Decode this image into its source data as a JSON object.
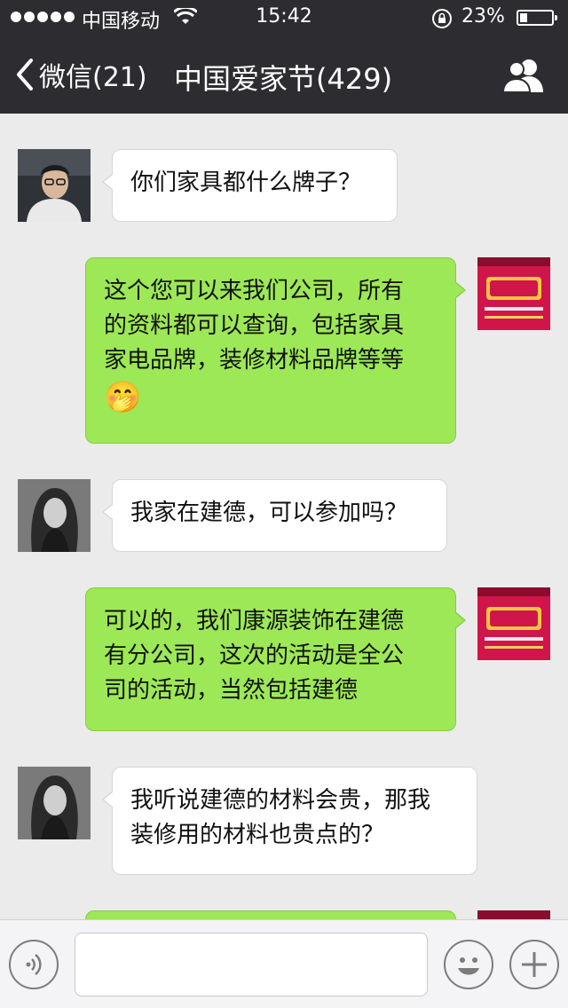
{
  "status_bar": {
    "carrier": "中国移动",
    "time": "15:42",
    "battery_percent_text": "23%",
    "battery_level": 0.23
  },
  "nav": {
    "back_label": "微信(21)",
    "title": "中国爱家节(429)"
  },
  "messages": [
    {
      "side": "left",
      "avatar": "male-user-photo",
      "text": "你们家具都什么牌子？"
    },
    {
      "side": "right",
      "avatar": "brand-logo-image",
      "lines": [
        "这个您可以来我们公司，所有",
        "的资料都可以查询，包括家具",
        "家电品牌，装修材料品牌等等"
      ],
      "emoji": "🤭"
    },
    {
      "side": "left",
      "avatar": "female-user-photo",
      "text": "我家在建德，可以参加吗？"
    },
    {
      "side": "right",
      "avatar": "brand-logo-image",
      "lines": [
        "可以的，我们康源装饰在建德",
        "有分公司，这次的活动是全公",
        "司的活动，当然包括建德"
      ]
    },
    {
      "side": "left",
      "avatar": "female-user-photo",
      "lines": [
        "我听说建德的材料会贵，那我",
        "装修用的材料也贵点的？"
      ]
    }
  ],
  "input_bar": {
    "voice_icon": "voice-icon",
    "emoji_icon": "smiley-icon",
    "more_icon": "plus-icon",
    "text_value": ""
  },
  "colors": {
    "nav_bg": "#2d2d31",
    "chat_bg": "#ebebeb",
    "bubble_right": "#9de856",
    "bubble_left": "#ffffff"
  }
}
